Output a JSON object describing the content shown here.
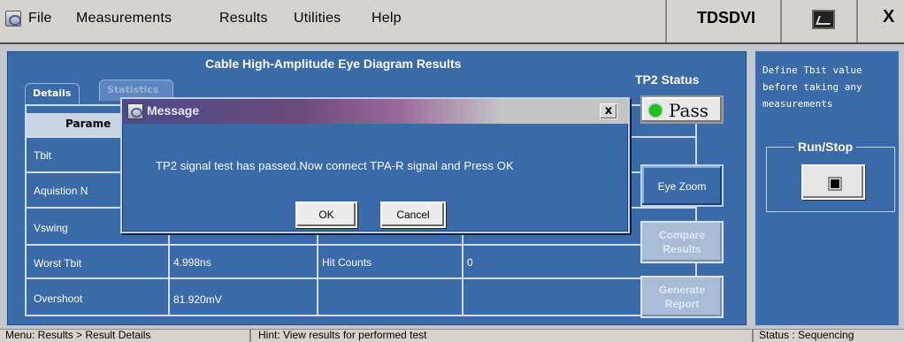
{
  "menubar": {
    "items": [
      "File",
      "Measurements",
      "Results",
      "Utilities",
      "Help"
    ],
    "app_title": "TDSDVI",
    "close_label": "X"
  },
  "main": {
    "title": "Cable High-Amplitude Eye Diagram Results",
    "tabs": [
      "Details",
      "Statistics"
    ],
    "table": {
      "header": "Parame",
      "rows": [
        {
          "label": "Tbit",
          "value": "",
          "label2": "",
          "value2": ""
        },
        {
          "label": "Aquistion N",
          "value": "",
          "label2": "",
          "value2": ""
        },
        {
          "label": "Vswing",
          "value": "",
          "label2": "",
          "value2": ""
        },
        {
          "label": "Worst Tbit",
          "value": "4.998ns",
          "label2": "Hit Counts",
          "value2": "0"
        },
        {
          "label": "Overshoot",
          "value": "81.920mV",
          "label2": "",
          "value2": ""
        }
      ]
    }
  },
  "tp2": {
    "title": "TP2 Status",
    "status": "Pass",
    "status_color": "#1cc41c"
  },
  "buttons": {
    "eye_zoom": "Eye Zoom",
    "compare_line1": "Compare",
    "compare_line2": "Results",
    "generate_line1": "Generate",
    "generate_line2": "Report"
  },
  "sidebar": {
    "note_lines": [
      "Define Tbit value",
      "before taking any",
      "measurements"
    ],
    "runstop_title": "Run/Stop"
  },
  "dialog": {
    "title": "Message",
    "message": "TP2 signal test has passed.Now connect TPA-R signal and Press OK",
    "ok_label": "OK",
    "cancel_label": "Cancel",
    "close_label": "x"
  },
  "statusbar": {
    "menu_path": "Menu: Results > Result Details",
    "hint": "Hint: View results for performed test",
    "status": "Status : Sequencing"
  },
  "colors": {
    "panel_blue": "#3a6aa8",
    "pass_green": "#1cc41c"
  }
}
